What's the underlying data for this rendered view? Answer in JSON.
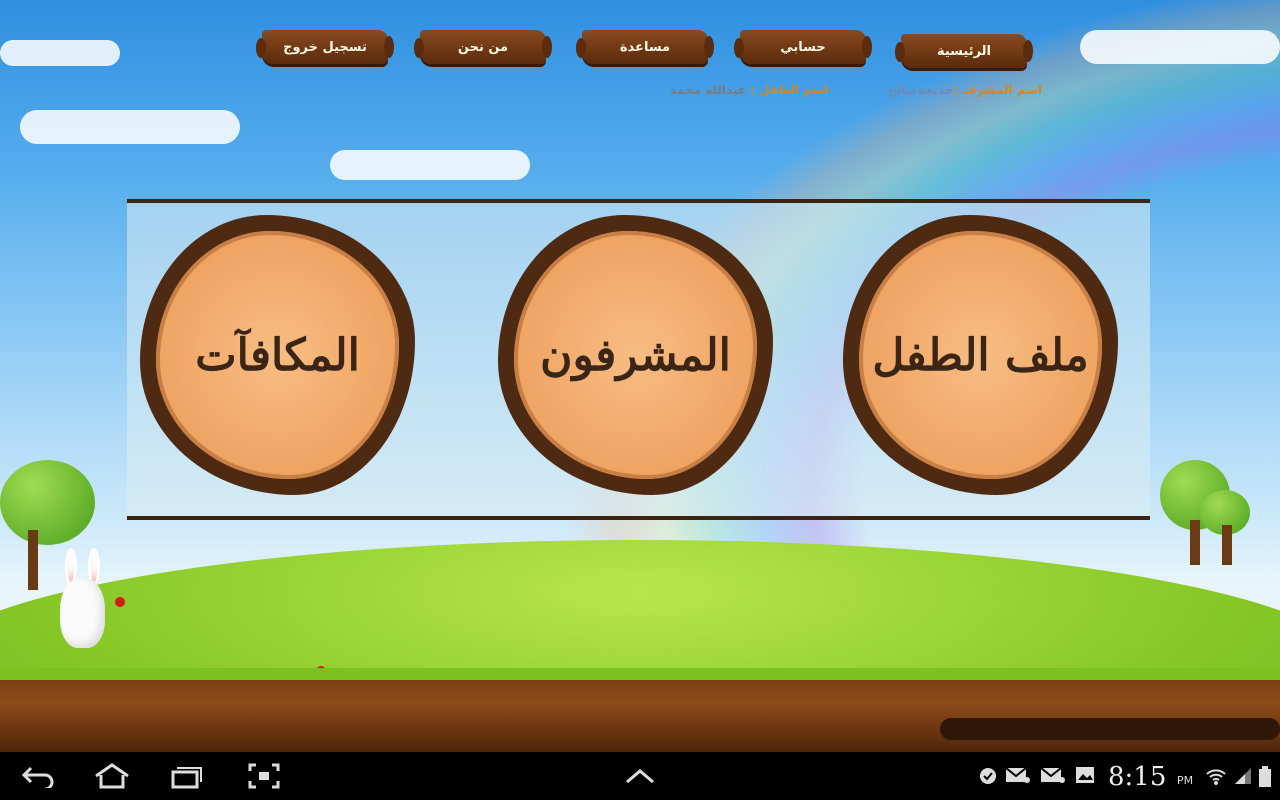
{
  "nav": {
    "home": "الرئيسية",
    "account": "حسابي",
    "help": "مساعدة",
    "about": "من نحن",
    "logout": "تسجيل خروج"
  },
  "info": {
    "supervisor_label": "اسم المشرف :",
    "supervisor_value": "خديجةصالح",
    "child_label": "اسم الطفل :",
    "child_value": "عبدالله محمد"
  },
  "cards": {
    "child_profile": "ملف الطفل",
    "supervisors": "المشرفون",
    "rewards": "المكافآت"
  },
  "system_bar": {
    "time": "8:15",
    "ampm": "PM",
    "back_icon": "back-icon",
    "home_icon": "home-icon",
    "recent_icon": "recent-apps-icon",
    "screenshot_icon": "screenshot-icon",
    "up_icon": "chevron-up-icon"
  },
  "colors": {
    "nav_plank": "#6b3510",
    "stump_wood": "#f2aa6a",
    "stump_bark": "#4e2a12",
    "label_orange": "#d8851b",
    "label_blue": "#7487b7"
  }
}
